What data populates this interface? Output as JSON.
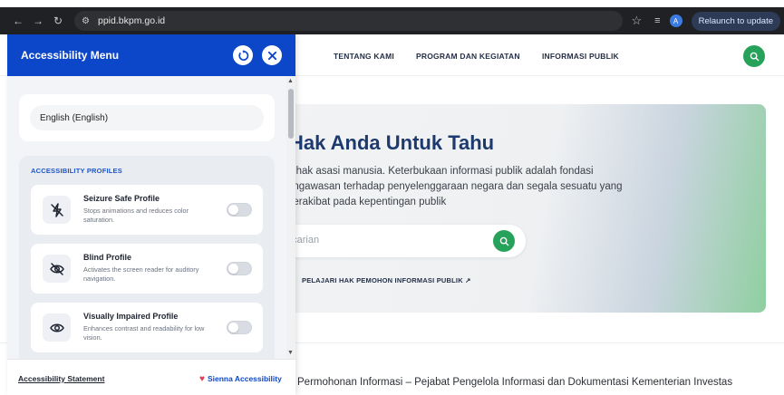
{
  "browser": {
    "back_icon": "arrow-left-icon",
    "forward_icon": "arrow-right-icon",
    "reload_icon": "reload-icon",
    "url": "ppid.bkpm.go.id",
    "profile_initial": "A",
    "relaunch_label": "Relaunch to update"
  },
  "site": {
    "nav": [
      "TENTANG KAMI",
      "PROGRAM DAN KEGIATAN",
      "INFORMASI PUBLIK"
    ],
    "hero_title": "Hak Anda Untuk Tahu",
    "hero_desc": "h hak asasi manusia. Keterbukaan informasi publik adalah fondasi engawasan terhadap penyelenggaraan negara dan segala sesuatu yang berakibat pada kepentingan publik",
    "search_placeholder": "ncarian",
    "hero_link": "PELAJARI HAK PEMOHON INFORMASI PUBLIK ↗",
    "footer_text": "Permohonan Informasi – Pejabat Pengelola Informasi dan Dokumentasi Kementerian Investas",
    "accent_green": "#27a25a",
    "title_color": "#1d3a6e"
  },
  "accessibility": {
    "title": "Accessibility Menu",
    "reset_icon": "reset-icon",
    "close_icon": "close-icon",
    "language": "English (English)",
    "profiles_heading": "ACCESSIBILITY PROFILES",
    "profiles": [
      {
        "title": "Seizure Safe Profile",
        "desc": "Stops animations and reduces color saturation.",
        "icon": "bolt-off-icon",
        "enabled": false
      },
      {
        "title": "Blind Profile",
        "desc": "Activates the screen reader for auditory navigation.",
        "icon": "eye-slash-icon",
        "enabled": false
      },
      {
        "title": "Visually Impaired Profile",
        "desc": "Enhances contrast and readability for low vision.",
        "icon": "eye-icon",
        "enabled": false
      }
    ],
    "statement_link": "Accessibility Statement",
    "brand": "Sienna Accessibility",
    "header_color": "#0d47c9"
  }
}
